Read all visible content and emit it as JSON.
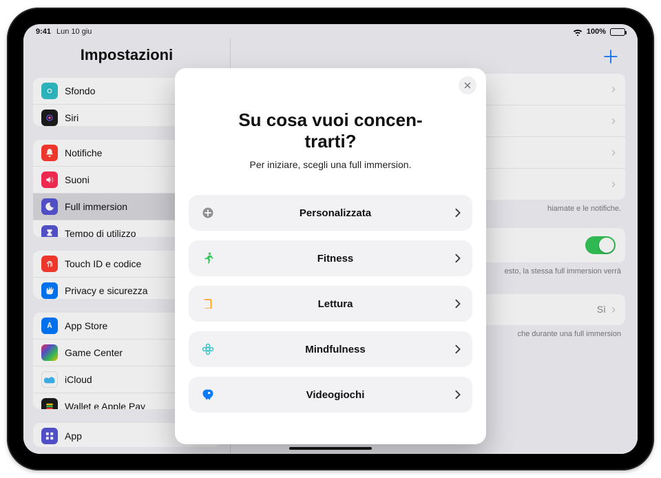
{
  "status": {
    "time": "9:41",
    "date": "Lun 10 giu",
    "battery_pct": "100%"
  },
  "sidebar": {
    "title": "Impostazioni",
    "g1": [
      {
        "label": "Sfondo"
      },
      {
        "label": "Siri"
      }
    ],
    "g2": [
      {
        "label": "Notifiche"
      },
      {
        "label": "Suoni"
      },
      {
        "label": "Full immersion"
      },
      {
        "label": "Tempo di utilizzo"
      }
    ],
    "g3": [
      {
        "label": "Touch ID e codice"
      },
      {
        "label": "Privacy e sicurezza"
      }
    ],
    "g4": [
      {
        "label": "App Store"
      },
      {
        "label": "Game Center"
      },
      {
        "label": "iCloud"
      },
      {
        "label": "Wallet e Apple Pay"
      }
    ],
    "g5": [
      {
        "label": "App"
      }
    ]
  },
  "main": {
    "hint_right": "hiamate e le notifiche.",
    "share_note1": "esto, la stessa full immersion verrà",
    "share_note2": "che durante una full immersion",
    "si_value": "Sì"
  },
  "modal": {
    "title_line1": "Su cosa vuoi concen-",
    "title_line2": "trarti?",
    "subtitle": "Per iniziare, scegli una full immersion.",
    "options": [
      {
        "label": "Personalizzata"
      },
      {
        "label": "Fitness"
      },
      {
        "label": "Lettura"
      },
      {
        "label": "Mindfulness"
      },
      {
        "label": "Videogiochi"
      }
    ]
  }
}
